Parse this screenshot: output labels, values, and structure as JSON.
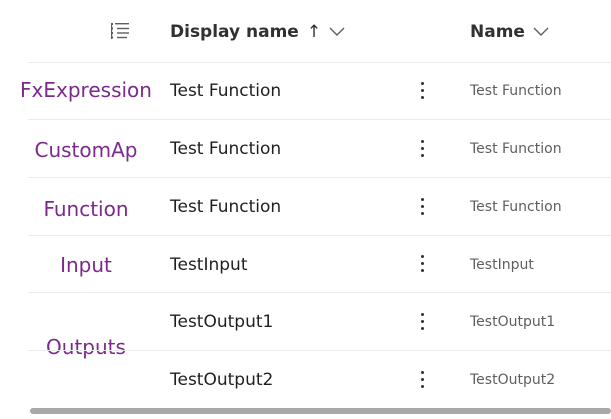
{
  "side_labels": [
    "FxExpression",
    "CustomAp",
    "Function",
    "Input",
    "Outputs"
  ],
  "header": {
    "icon": "column-options-icon",
    "display_name_label": "Display name",
    "display_name_sort": "↑",
    "name_label": "Name"
  },
  "rows": [
    {
      "display_name": "Test Function",
      "name": "Test Function"
    },
    {
      "display_name": "Test Function",
      "name": "Test Function"
    },
    {
      "display_name": "Test Function",
      "name": "Test Function"
    },
    {
      "display_name": "TestInput",
      "name": "TestInput"
    },
    {
      "display_name": "TestOutput1",
      "name": "TestOutput1"
    },
    {
      "display_name": "TestOutput2",
      "name": "TestOutput2"
    }
  ],
  "colors": {
    "side_label": "#7b2a8c",
    "header_text": "#323130",
    "row_text": "#201f1e",
    "name_text": "#605e5c",
    "divider": "#ebebeb",
    "scrollbar": "#a8a8a8"
  }
}
